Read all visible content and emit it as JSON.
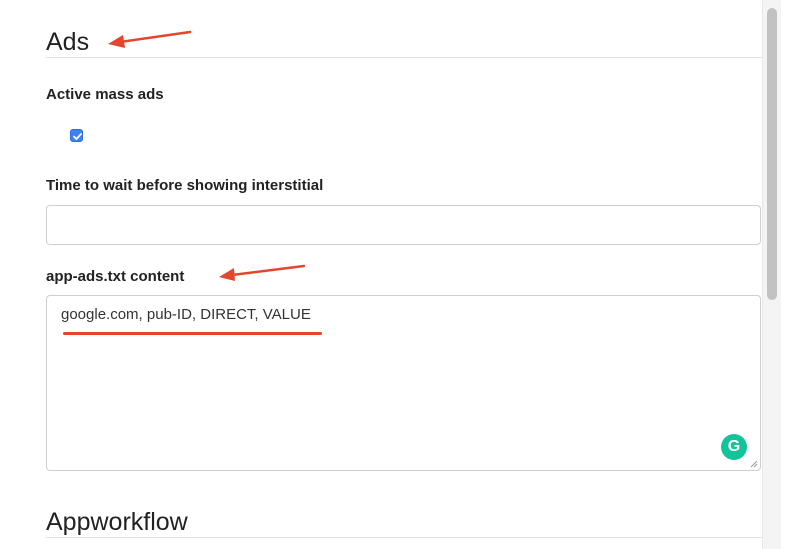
{
  "sections": {
    "ads_title": "Ads",
    "appworkflow_title": "Appworkflow"
  },
  "fields": {
    "active_mass_ads": {
      "label": "Active mass ads",
      "checked": true
    },
    "interstitial_wait": {
      "label": "Time to wait before showing interstitial",
      "value": "",
      "placeholder": ""
    },
    "app_ads_txt": {
      "label": "app-ads.txt content",
      "value": "google.com, pub-ID, DIRECT, VALUE"
    }
  },
  "icons": {
    "grammarly": "grammarly-icon",
    "grammarly_letter": "G",
    "checkmark": "checkmark-icon"
  },
  "colors": {
    "annotation": "#e2472d",
    "checkbox": "#3b82f6",
    "grammarly": "#15c39a"
  }
}
